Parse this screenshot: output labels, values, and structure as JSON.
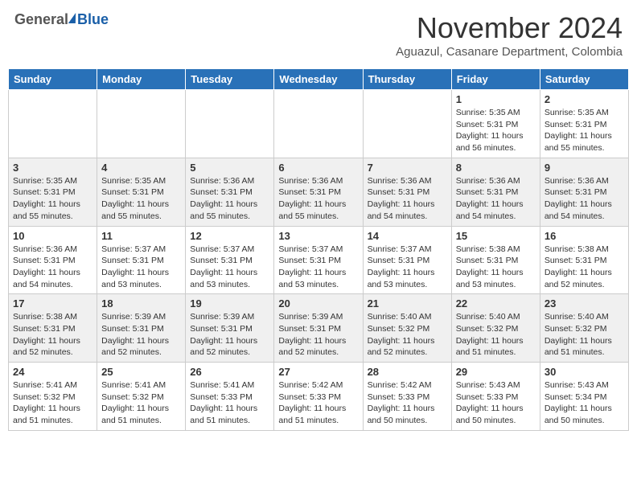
{
  "header": {
    "logo_general": "General",
    "logo_blue": "Blue",
    "month": "November 2024",
    "location": "Aguazul, Casanare Department, Colombia"
  },
  "weekdays": [
    "Sunday",
    "Monday",
    "Tuesday",
    "Wednesday",
    "Thursday",
    "Friday",
    "Saturday"
  ],
  "weeks": [
    [
      {
        "day": "",
        "empty": true
      },
      {
        "day": "",
        "empty": true
      },
      {
        "day": "",
        "empty": true
      },
      {
        "day": "",
        "empty": true
      },
      {
        "day": "",
        "empty": true
      },
      {
        "day": "1",
        "sunrise": "5:35 AM",
        "sunset": "5:31 PM",
        "daylight": "11 hours and 56 minutes."
      },
      {
        "day": "2",
        "sunrise": "5:35 AM",
        "sunset": "5:31 PM",
        "daylight": "11 hours and 55 minutes."
      }
    ],
    [
      {
        "day": "3",
        "sunrise": "5:35 AM",
        "sunset": "5:31 PM",
        "daylight": "11 hours and 55 minutes."
      },
      {
        "day": "4",
        "sunrise": "5:35 AM",
        "sunset": "5:31 PM",
        "daylight": "11 hours and 55 minutes."
      },
      {
        "day": "5",
        "sunrise": "5:36 AM",
        "sunset": "5:31 PM",
        "daylight": "11 hours and 55 minutes."
      },
      {
        "day": "6",
        "sunrise": "5:36 AM",
        "sunset": "5:31 PM",
        "daylight": "11 hours and 55 minutes."
      },
      {
        "day": "7",
        "sunrise": "5:36 AM",
        "sunset": "5:31 PM",
        "daylight": "11 hours and 54 minutes."
      },
      {
        "day": "8",
        "sunrise": "5:36 AM",
        "sunset": "5:31 PM",
        "daylight": "11 hours and 54 minutes."
      },
      {
        "day": "9",
        "sunrise": "5:36 AM",
        "sunset": "5:31 PM",
        "daylight": "11 hours and 54 minutes."
      }
    ],
    [
      {
        "day": "10",
        "sunrise": "5:36 AM",
        "sunset": "5:31 PM",
        "daylight": "11 hours and 54 minutes."
      },
      {
        "day": "11",
        "sunrise": "5:37 AM",
        "sunset": "5:31 PM",
        "daylight": "11 hours and 53 minutes."
      },
      {
        "day": "12",
        "sunrise": "5:37 AM",
        "sunset": "5:31 PM",
        "daylight": "11 hours and 53 minutes."
      },
      {
        "day": "13",
        "sunrise": "5:37 AM",
        "sunset": "5:31 PM",
        "daylight": "11 hours and 53 minutes."
      },
      {
        "day": "14",
        "sunrise": "5:37 AM",
        "sunset": "5:31 PM",
        "daylight": "11 hours and 53 minutes."
      },
      {
        "day": "15",
        "sunrise": "5:38 AM",
        "sunset": "5:31 PM",
        "daylight": "11 hours and 53 minutes."
      },
      {
        "day": "16",
        "sunrise": "5:38 AM",
        "sunset": "5:31 PM",
        "daylight": "11 hours and 52 minutes."
      }
    ],
    [
      {
        "day": "17",
        "sunrise": "5:38 AM",
        "sunset": "5:31 PM",
        "daylight": "11 hours and 52 minutes."
      },
      {
        "day": "18",
        "sunrise": "5:39 AM",
        "sunset": "5:31 PM",
        "daylight": "11 hours and 52 minutes."
      },
      {
        "day": "19",
        "sunrise": "5:39 AM",
        "sunset": "5:31 PM",
        "daylight": "11 hours and 52 minutes."
      },
      {
        "day": "20",
        "sunrise": "5:39 AM",
        "sunset": "5:31 PM",
        "daylight": "11 hours and 52 minutes."
      },
      {
        "day": "21",
        "sunrise": "5:40 AM",
        "sunset": "5:32 PM",
        "daylight": "11 hours and 52 minutes."
      },
      {
        "day": "22",
        "sunrise": "5:40 AM",
        "sunset": "5:32 PM",
        "daylight": "11 hours and 51 minutes."
      },
      {
        "day": "23",
        "sunrise": "5:40 AM",
        "sunset": "5:32 PM",
        "daylight": "11 hours and 51 minutes."
      }
    ],
    [
      {
        "day": "24",
        "sunrise": "5:41 AM",
        "sunset": "5:32 PM",
        "daylight": "11 hours and 51 minutes."
      },
      {
        "day": "25",
        "sunrise": "5:41 AM",
        "sunset": "5:32 PM",
        "daylight": "11 hours and 51 minutes."
      },
      {
        "day": "26",
        "sunrise": "5:41 AM",
        "sunset": "5:33 PM",
        "daylight": "11 hours and 51 minutes."
      },
      {
        "day": "27",
        "sunrise": "5:42 AM",
        "sunset": "5:33 PM",
        "daylight": "11 hours and 51 minutes."
      },
      {
        "day": "28",
        "sunrise": "5:42 AM",
        "sunset": "5:33 PM",
        "daylight": "11 hours and 50 minutes."
      },
      {
        "day": "29",
        "sunrise": "5:43 AM",
        "sunset": "5:33 PM",
        "daylight": "11 hours and 50 minutes."
      },
      {
        "day": "30",
        "sunrise": "5:43 AM",
        "sunset": "5:34 PM",
        "daylight": "11 hours and 50 minutes."
      }
    ]
  ]
}
